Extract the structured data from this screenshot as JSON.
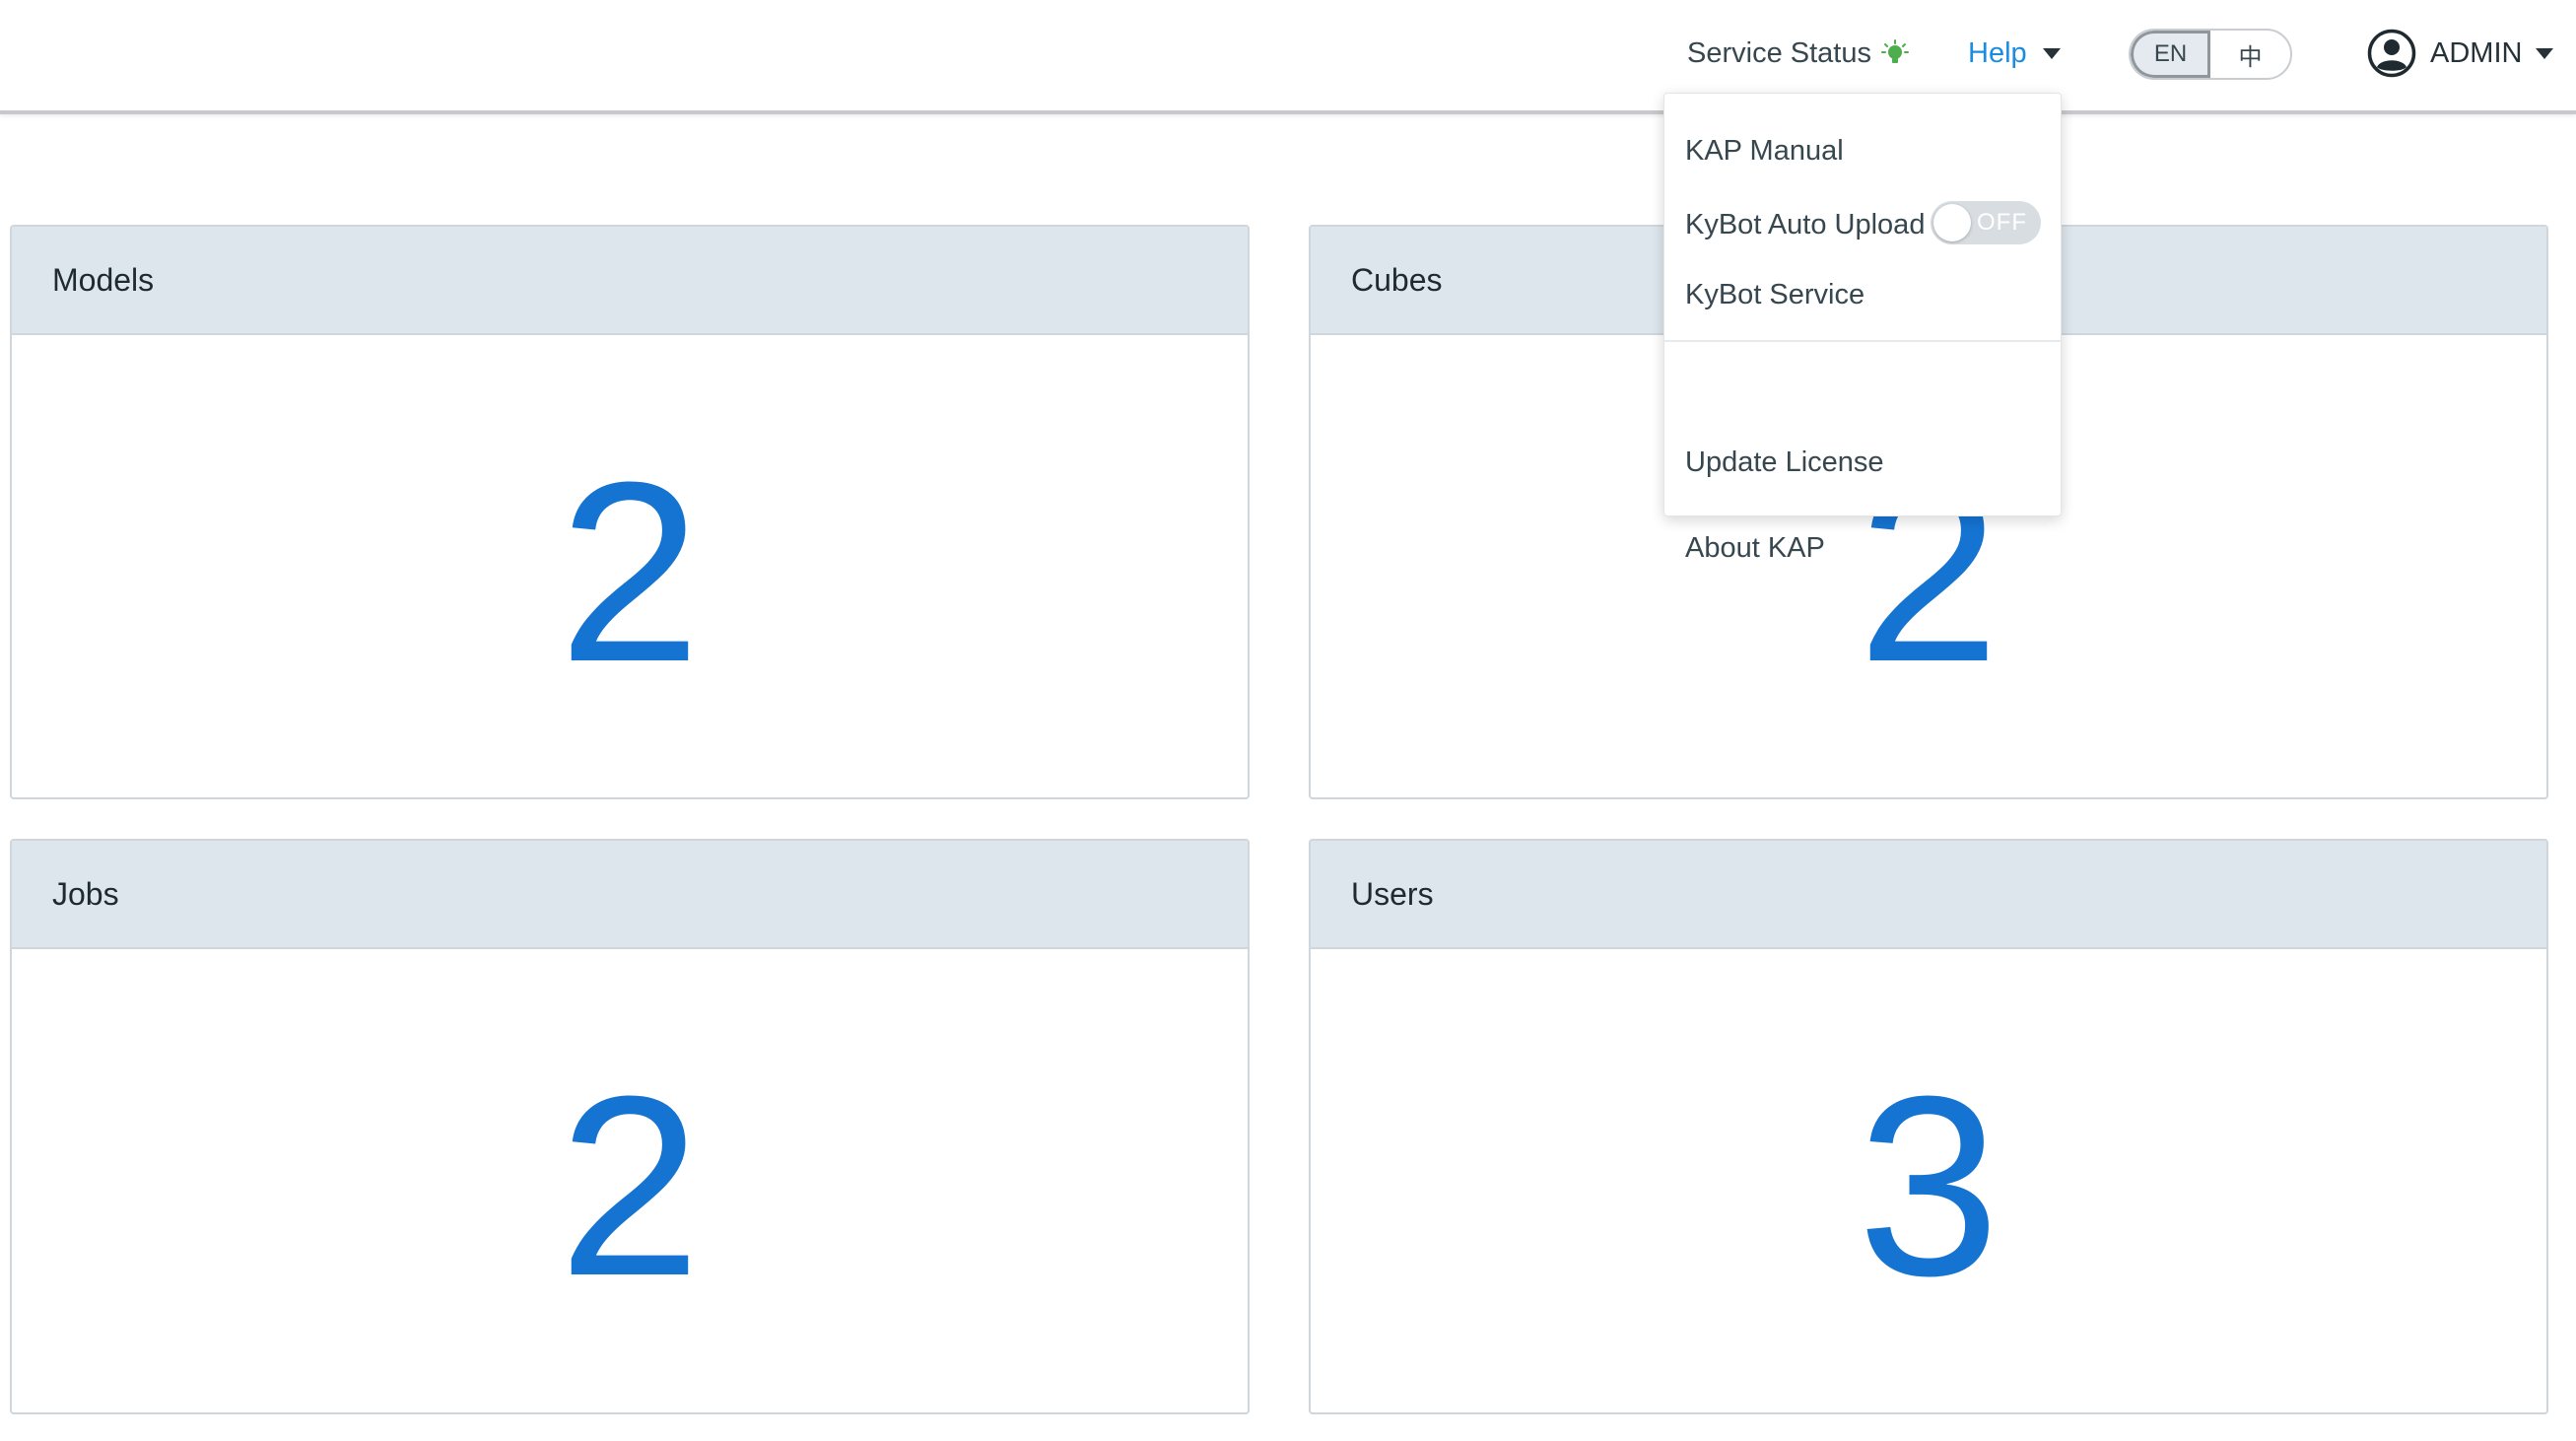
{
  "header": {
    "service_status_label": "Service Status",
    "service_status_color": "#4cae4c",
    "help_label": "Help",
    "language": {
      "options": [
        "EN",
        "中"
      ],
      "selected": "EN"
    },
    "user_label": "ADMIN"
  },
  "cards": {
    "models": {
      "title": "Models",
      "count": "2"
    },
    "cubes": {
      "title": "Cubes",
      "count": "2"
    },
    "jobs": {
      "title": "Jobs",
      "count": "2"
    },
    "users": {
      "title": "Users",
      "count": "3"
    }
  },
  "help_dropdown": {
    "items": [
      {
        "label": "KAP Manual"
      },
      {
        "label": "KyBot Auto Upload",
        "toggle": {
          "state": "OFF"
        }
      },
      {
        "label": "KyBot Service"
      },
      {
        "label": "Update License"
      },
      {
        "label": "About KAP"
      }
    ]
  },
  "colors": {
    "accent": "#1574d2",
    "link": "#1a8de0",
    "card_header_bg": "#dde6ec"
  }
}
